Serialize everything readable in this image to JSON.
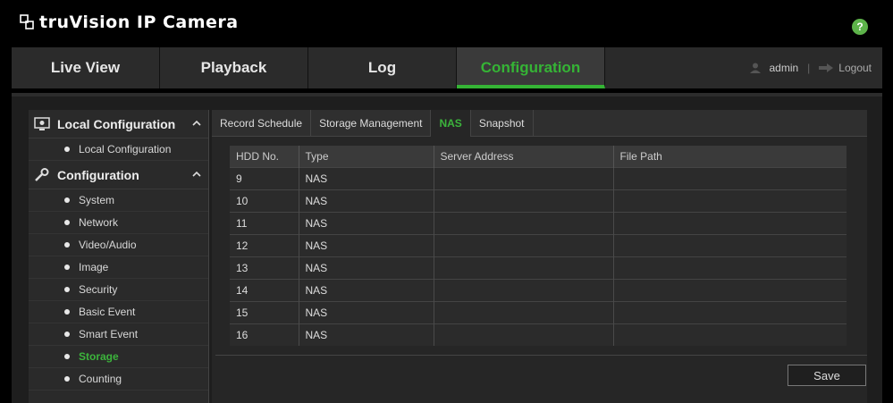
{
  "app": {
    "title": "truVision IP Camera",
    "help": "?"
  },
  "nav": {
    "tabs": [
      {
        "label": "Live View"
      },
      {
        "label": "Playback"
      },
      {
        "label": "Log"
      },
      {
        "label": "Configuration",
        "active": true
      }
    ],
    "user": "admin",
    "logout": "Logout"
  },
  "sidebar": {
    "sections": [
      {
        "title": "Local Configuration",
        "icon": "monitor-gear-icon",
        "items": [
          "Local Configuration"
        ]
      },
      {
        "title": "Configuration",
        "icon": "wrench-icon",
        "items": [
          "System",
          "Network",
          "Video/Audio",
          "Image",
          "Security",
          "Basic Event",
          "Smart Event",
          "Storage",
          "Counting"
        ]
      }
    ],
    "active_item": "Storage"
  },
  "subtabs": [
    "Record Schedule",
    "Storage Management",
    "NAS",
    "Snapshot"
  ],
  "active_subtab": "NAS",
  "table": {
    "headers": [
      "HDD No.",
      "Type",
      "Server Address",
      "File Path"
    ],
    "rows": [
      [
        "9",
        "NAS",
        "",
        ""
      ],
      [
        "10",
        "NAS",
        "",
        ""
      ],
      [
        "11",
        "NAS",
        "",
        ""
      ],
      [
        "12",
        "NAS",
        "",
        ""
      ],
      [
        "13",
        "NAS",
        "",
        ""
      ],
      [
        "14",
        "NAS",
        "",
        ""
      ],
      [
        "15",
        "NAS",
        "",
        ""
      ],
      [
        "16",
        "NAS",
        "",
        ""
      ]
    ]
  },
  "buttons": {
    "save": "Save"
  },
  "colors": {
    "accent": "#35b435",
    "help": "#5db34a"
  }
}
